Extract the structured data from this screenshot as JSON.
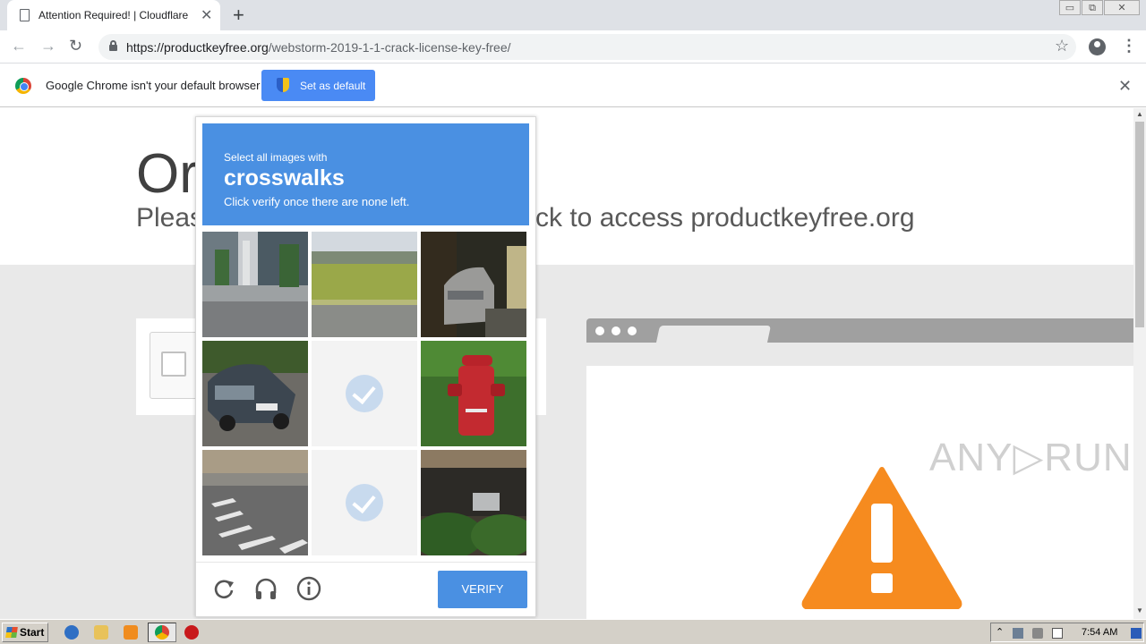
{
  "tab": {
    "title": "Attention Required! | Cloudflare",
    "close": "✕"
  },
  "newtab": "+",
  "window_controls": {
    "minimize": "▭",
    "restore": "⧉",
    "close": "✕"
  },
  "nav": {
    "back": "←",
    "forward": "→",
    "reload": "↻"
  },
  "address": {
    "host": "https://productkeyfree.org",
    "path": "/webstorm-2019-1-1-crack-license-key-free/"
  },
  "toolbar_icons": {
    "star": "☆",
    "menu": "⋮"
  },
  "infobar": {
    "message": "Google Chrome isn't your default browser",
    "button": "Set as default",
    "close": "✕"
  },
  "page": {
    "headline_fragment": "Or",
    "subline_fragment_left": "Pleas",
    "subline_fragment_right": "ck to access productkeyfree.org",
    "watermark": "ANY▷RUN"
  },
  "challenge": {
    "instruction": "Select all images with",
    "target": "crosswalks",
    "hint": "Click verify once there are none left.",
    "verify": "VERIFY",
    "tiles": [
      {
        "name": "tile-building-sidewalk",
        "selected": false
      },
      {
        "name": "tile-grass-field",
        "selected": false
      },
      {
        "name": "tile-parked-car-night",
        "selected": false
      },
      {
        "name": "tile-dark-car",
        "selected": false
      },
      {
        "name": "tile-blank-selected-1",
        "selected": true
      },
      {
        "name": "tile-fire-hydrant",
        "selected": false
      },
      {
        "name": "tile-crosswalk-street",
        "selected": false
      },
      {
        "name": "tile-blank-selected-2",
        "selected": true
      },
      {
        "name": "tile-building-bushes",
        "selected": false
      }
    ]
  },
  "taskbar": {
    "start": "Start",
    "clock": "7:54 AM"
  },
  "colors": {
    "accent": "#4a90e2",
    "chrome_blue": "#4a8af4",
    "warning": "#f68b1f"
  },
  "icons": [
    "page-icon",
    "lock-icon",
    "star-icon",
    "profile-icon",
    "menu-icon",
    "chrome-logo-icon",
    "shield-icon",
    "refresh-icon",
    "audio-icon",
    "info-icon",
    "warning-icon"
  ]
}
